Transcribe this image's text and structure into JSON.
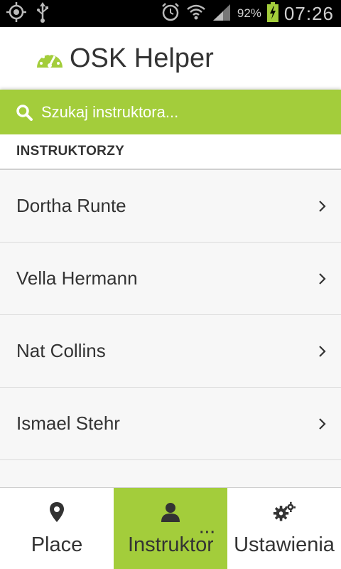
{
  "status_bar": {
    "battery_percent": "92%",
    "time": "07:26",
    "icons": [
      "gps-icon",
      "usb-icon",
      "alarm-icon",
      "wifi-icon",
      "signal-icon",
      "battery-charging-icon"
    ]
  },
  "app": {
    "title": "OSK Helper",
    "logo_icon": "speedometer-icon"
  },
  "search": {
    "placeholder": "Szukaj instruktora..."
  },
  "section": {
    "title": "INSTRUKTORZY"
  },
  "instructors": [
    {
      "name": "Dortha Runte"
    },
    {
      "name": "Vella Hermann"
    },
    {
      "name": "Nat Collins"
    },
    {
      "name": "Ismael Stehr"
    }
  ],
  "bottom_nav": {
    "tabs": [
      {
        "label": "Place",
        "icon": "map-marker-icon",
        "active": false
      },
      {
        "label": "Instruktorzy",
        "icon": "user-icon",
        "active": true
      },
      {
        "label": "Ustawienia",
        "icon": "gears-icon",
        "active": false
      }
    ]
  },
  "colors": {
    "accent": "#a3cd3b",
    "status_bar": "#000000",
    "text": "#333333"
  }
}
